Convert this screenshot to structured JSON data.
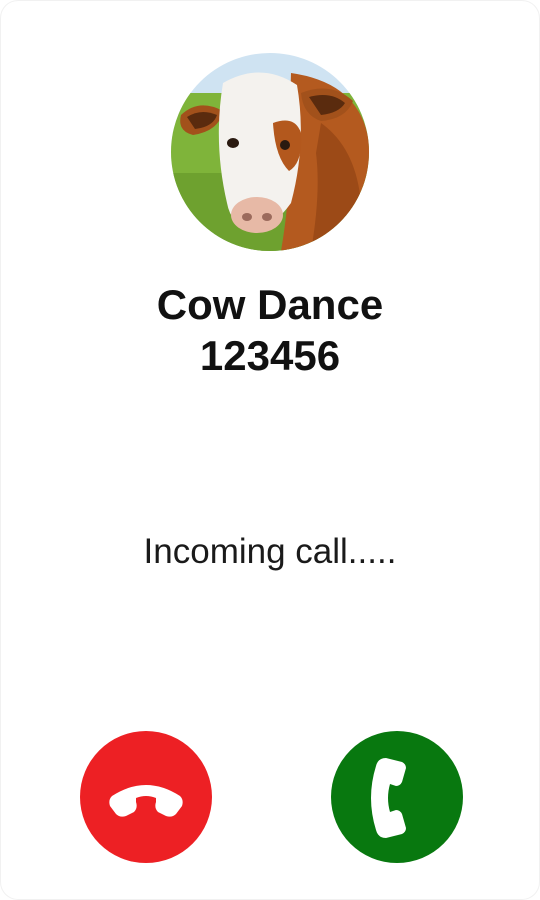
{
  "caller": {
    "name": "Cow Dance",
    "number": "123456",
    "avatar_icon": "cow-photo"
  },
  "status": {
    "text": "Incoming call....."
  },
  "actions": {
    "decline_icon": "phone-hangup-icon",
    "accept_icon": "phone-answer-icon"
  },
  "colors": {
    "decline": "#ed2024",
    "accept": "#08780f",
    "text": "#111111",
    "background": "#ffffff"
  }
}
